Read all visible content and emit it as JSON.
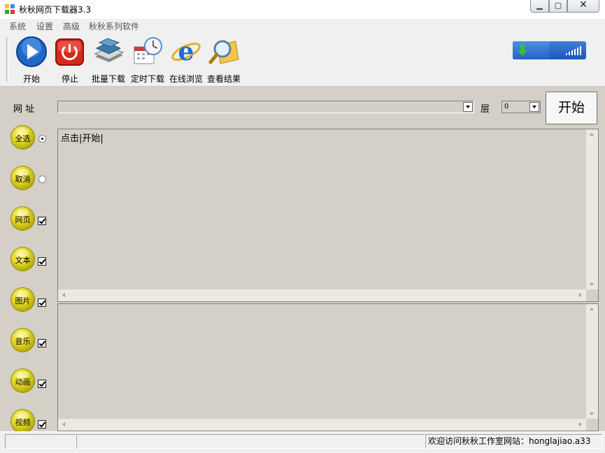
{
  "window": {
    "title": "秋秋网页下载器3.3"
  },
  "menu": [
    "系统",
    "设置",
    "高级",
    "秋秋系列软件"
  ],
  "toolbar": {
    "start": "开始",
    "stop": "停止",
    "batch": "批量下载",
    "timed": "定时下载",
    "browse": "在线浏览",
    "results": "查看结果"
  },
  "url_row": {
    "url_label": "网 址",
    "url_value": "",
    "depth_label": "层",
    "depth_value": "0",
    "start_button": "开始"
  },
  "log": {
    "text": "点击|开始|"
  },
  "side": {
    "select_all": "全选",
    "cancel": "取消",
    "webpage": "网页",
    "text": "文本",
    "image": "图片",
    "music": "音乐",
    "animation": "动画",
    "video": "视频"
  },
  "status": {
    "welcome": "欢迎访问秋秋工作室网站：honglajiao.a33"
  },
  "colors": {
    "accent_blue": "#1b57b8",
    "button_yellow": "#e8de30"
  }
}
